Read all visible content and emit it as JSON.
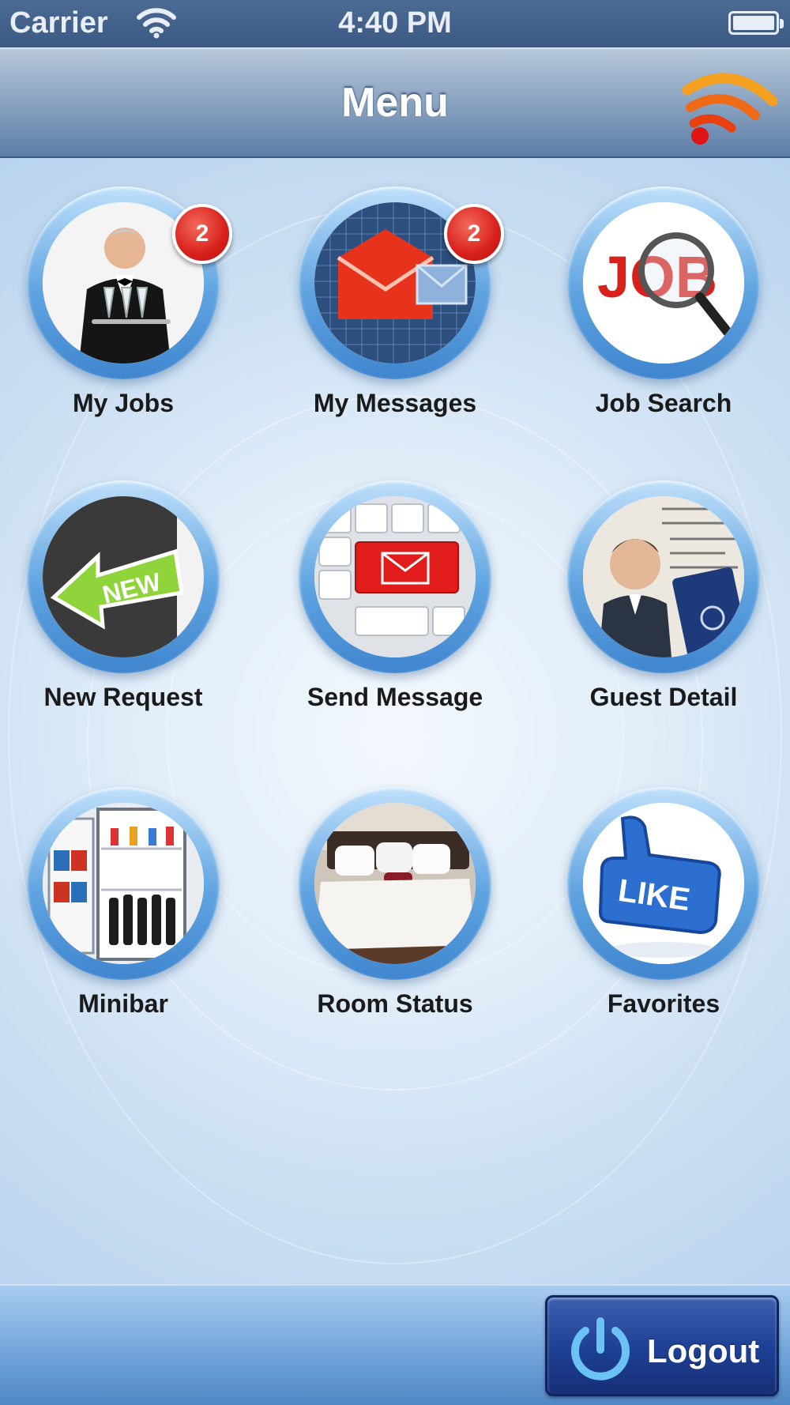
{
  "status_bar": {
    "carrier": "Carrier",
    "time": "4:40 PM",
    "wifi_icon": "wifi-icon",
    "battery_icon": "battery-icon"
  },
  "nav_bar": {
    "title": "Menu",
    "feed_icon": "rss-feed-icon"
  },
  "menu_items": [
    {
      "label": "My Jobs",
      "badge": "2",
      "icon": "waiter-icon"
    },
    {
      "label": "My Messages",
      "badge": "2",
      "icon": "envelope-icon"
    },
    {
      "label": "Job Search",
      "icon": "job-search-icon"
    },
    {
      "label": "New Request",
      "icon": "new-arrow-icon"
    },
    {
      "label": "Send Message",
      "icon": "keyboard-mail-icon"
    },
    {
      "label": "Guest Detail",
      "icon": "passport-icon"
    },
    {
      "label": "Minibar",
      "icon": "minibar-icon"
    },
    {
      "label": "Room Status",
      "icon": "bed-icon"
    },
    {
      "label": "Favorites",
      "icon": "like-icon"
    }
  ],
  "bottom_bar": {
    "logout_label": "Logout",
    "power_icon": "power-icon"
  },
  "colors": {
    "nav_bar": "#8ea7c3",
    "badge": "#d8201b",
    "ring": "#5fa3e0",
    "logout": "#1d3f93"
  }
}
